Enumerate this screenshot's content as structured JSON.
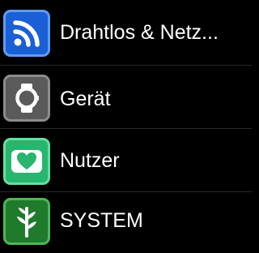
{
  "settings_menu": {
    "items": [
      {
        "label": "Drahtlos & Netz...",
        "icon": "wireless-icon",
        "accent": "#1a5fd6"
      },
      {
        "label": "Gerät",
        "icon": "watch-icon",
        "accent": "#5a5a5a"
      },
      {
        "label": "Nutzer",
        "icon": "heart-icon",
        "accent": "#28b66f"
      },
      {
        "label": "SYSTEM",
        "icon": "plant-icon",
        "accent": "#1f7a2c"
      }
    ]
  }
}
